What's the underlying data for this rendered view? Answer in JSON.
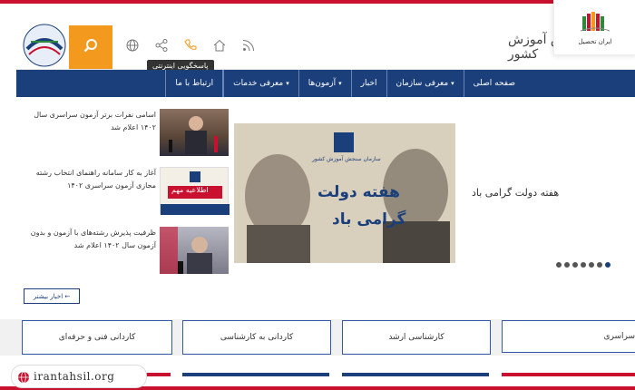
{
  "header": {
    "org_name": "سازمان سنجش آموزش کشور",
    "tooltip": "پاسخگویی اینترنتی"
  },
  "badge": {
    "text": "ایران تحصیل"
  },
  "nav": {
    "items": [
      {
        "label": "صفحه اصلی",
        "has_menu": false
      },
      {
        "label": "معرفی سازمان",
        "has_menu": true
      },
      {
        "label": "اخبار",
        "has_menu": false
      },
      {
        "label": "آزمون‌ها",
        "has_menu": true
      },
      {
        "label": "معرفی خدمات",
        "has_menu": true
      },
      {
        "label": "ارتباط با ما",
        "has_menu": false
      }
    ],
    "chevron": "▾"
  },
  "news": [
    {
      "text": "اسامی نفرات برتر آزمون سراسری سال ۱۴۰۲ اعلام شد"
    },
    {
      "text": "آغاز به کار سامانه راهنمای انتخاب رشته مجازی آزمون سراسری ۱۴۰۲"
    },
    {
      "text": "ظرفیت پذیرش رشته‌های با آزمون و بدون آزمون سال ۱۴۰۲ اعلام شد"
    }
  ],
  "thumb2_label": "اطلاعیه مهم",
  "slider": {
    "caption": "هفته دولت گرامی باد",
    "banner_line1": "هفته دولت",
    "banner_line2": "گرامی باد",
    "banner_org": "سازمان سنجش آموزش کشور",
    "dot_count": 7,
    "active_dot": 0
  },
  "more_button": "اخبار بیشتر ←",
  "categories": [
    "سراسری",
    "کارشناسی ارشد",
    "کاردانی به کارشناسی",
    "کاردانی فنی و حرفه‌ای"
  ],
  "watermark": "irantahsil.org",
  "colors": {
    "nav": "#1b3f7a",
    "accent": "#f39a1e",
    "brand_red": "#c9102e"
  }
}
